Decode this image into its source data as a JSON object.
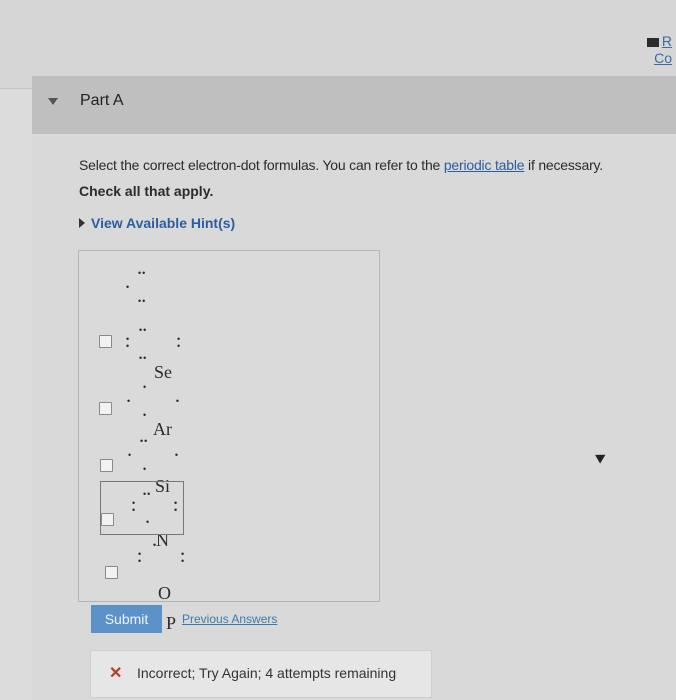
{
  "top_right": {
    "line1": "R",
    "line2": "Co"
  },
  "part": {
    "title": "Part A"
  },
  "instructions": {
    "prefix": "Select the correct electron-dot formulas. You can refer to the",
    "link": "periodic table",
    "suffix": "if necessary.",
    "check_all": "Check all that apply."
  },
  "hint": {
    "label": "View Available Hint(s)"
  },
  "options": [
    {
      "symbol": "Se",
      "checked": false
    },
    {
      "symbol": "Ar",
      "checked": false
    },
    {
      "symbol": "Si",
      "checked": false
    },
    {
      "symbol": "N",
      "checked": false
    },
    {
      "symbol": "O",
      "checked": false,
      "selected": true
    },
    {
      "symbol": "P",
      "checked": false
    }
  ],
  "actions": {
    "submit_label": "Submit",
    "previous_answers_label": "Previous Answers"
  },
  "feedback": {
    "icon": "x-icon",
    "message": "Incorrect; Try Again; 4 attempts remaining"
  },
  "colors": {
    "link": "#2d5da0",
    "submit_bg": "#5b93c9",
    "error": "#b73a2a"
  }
}
